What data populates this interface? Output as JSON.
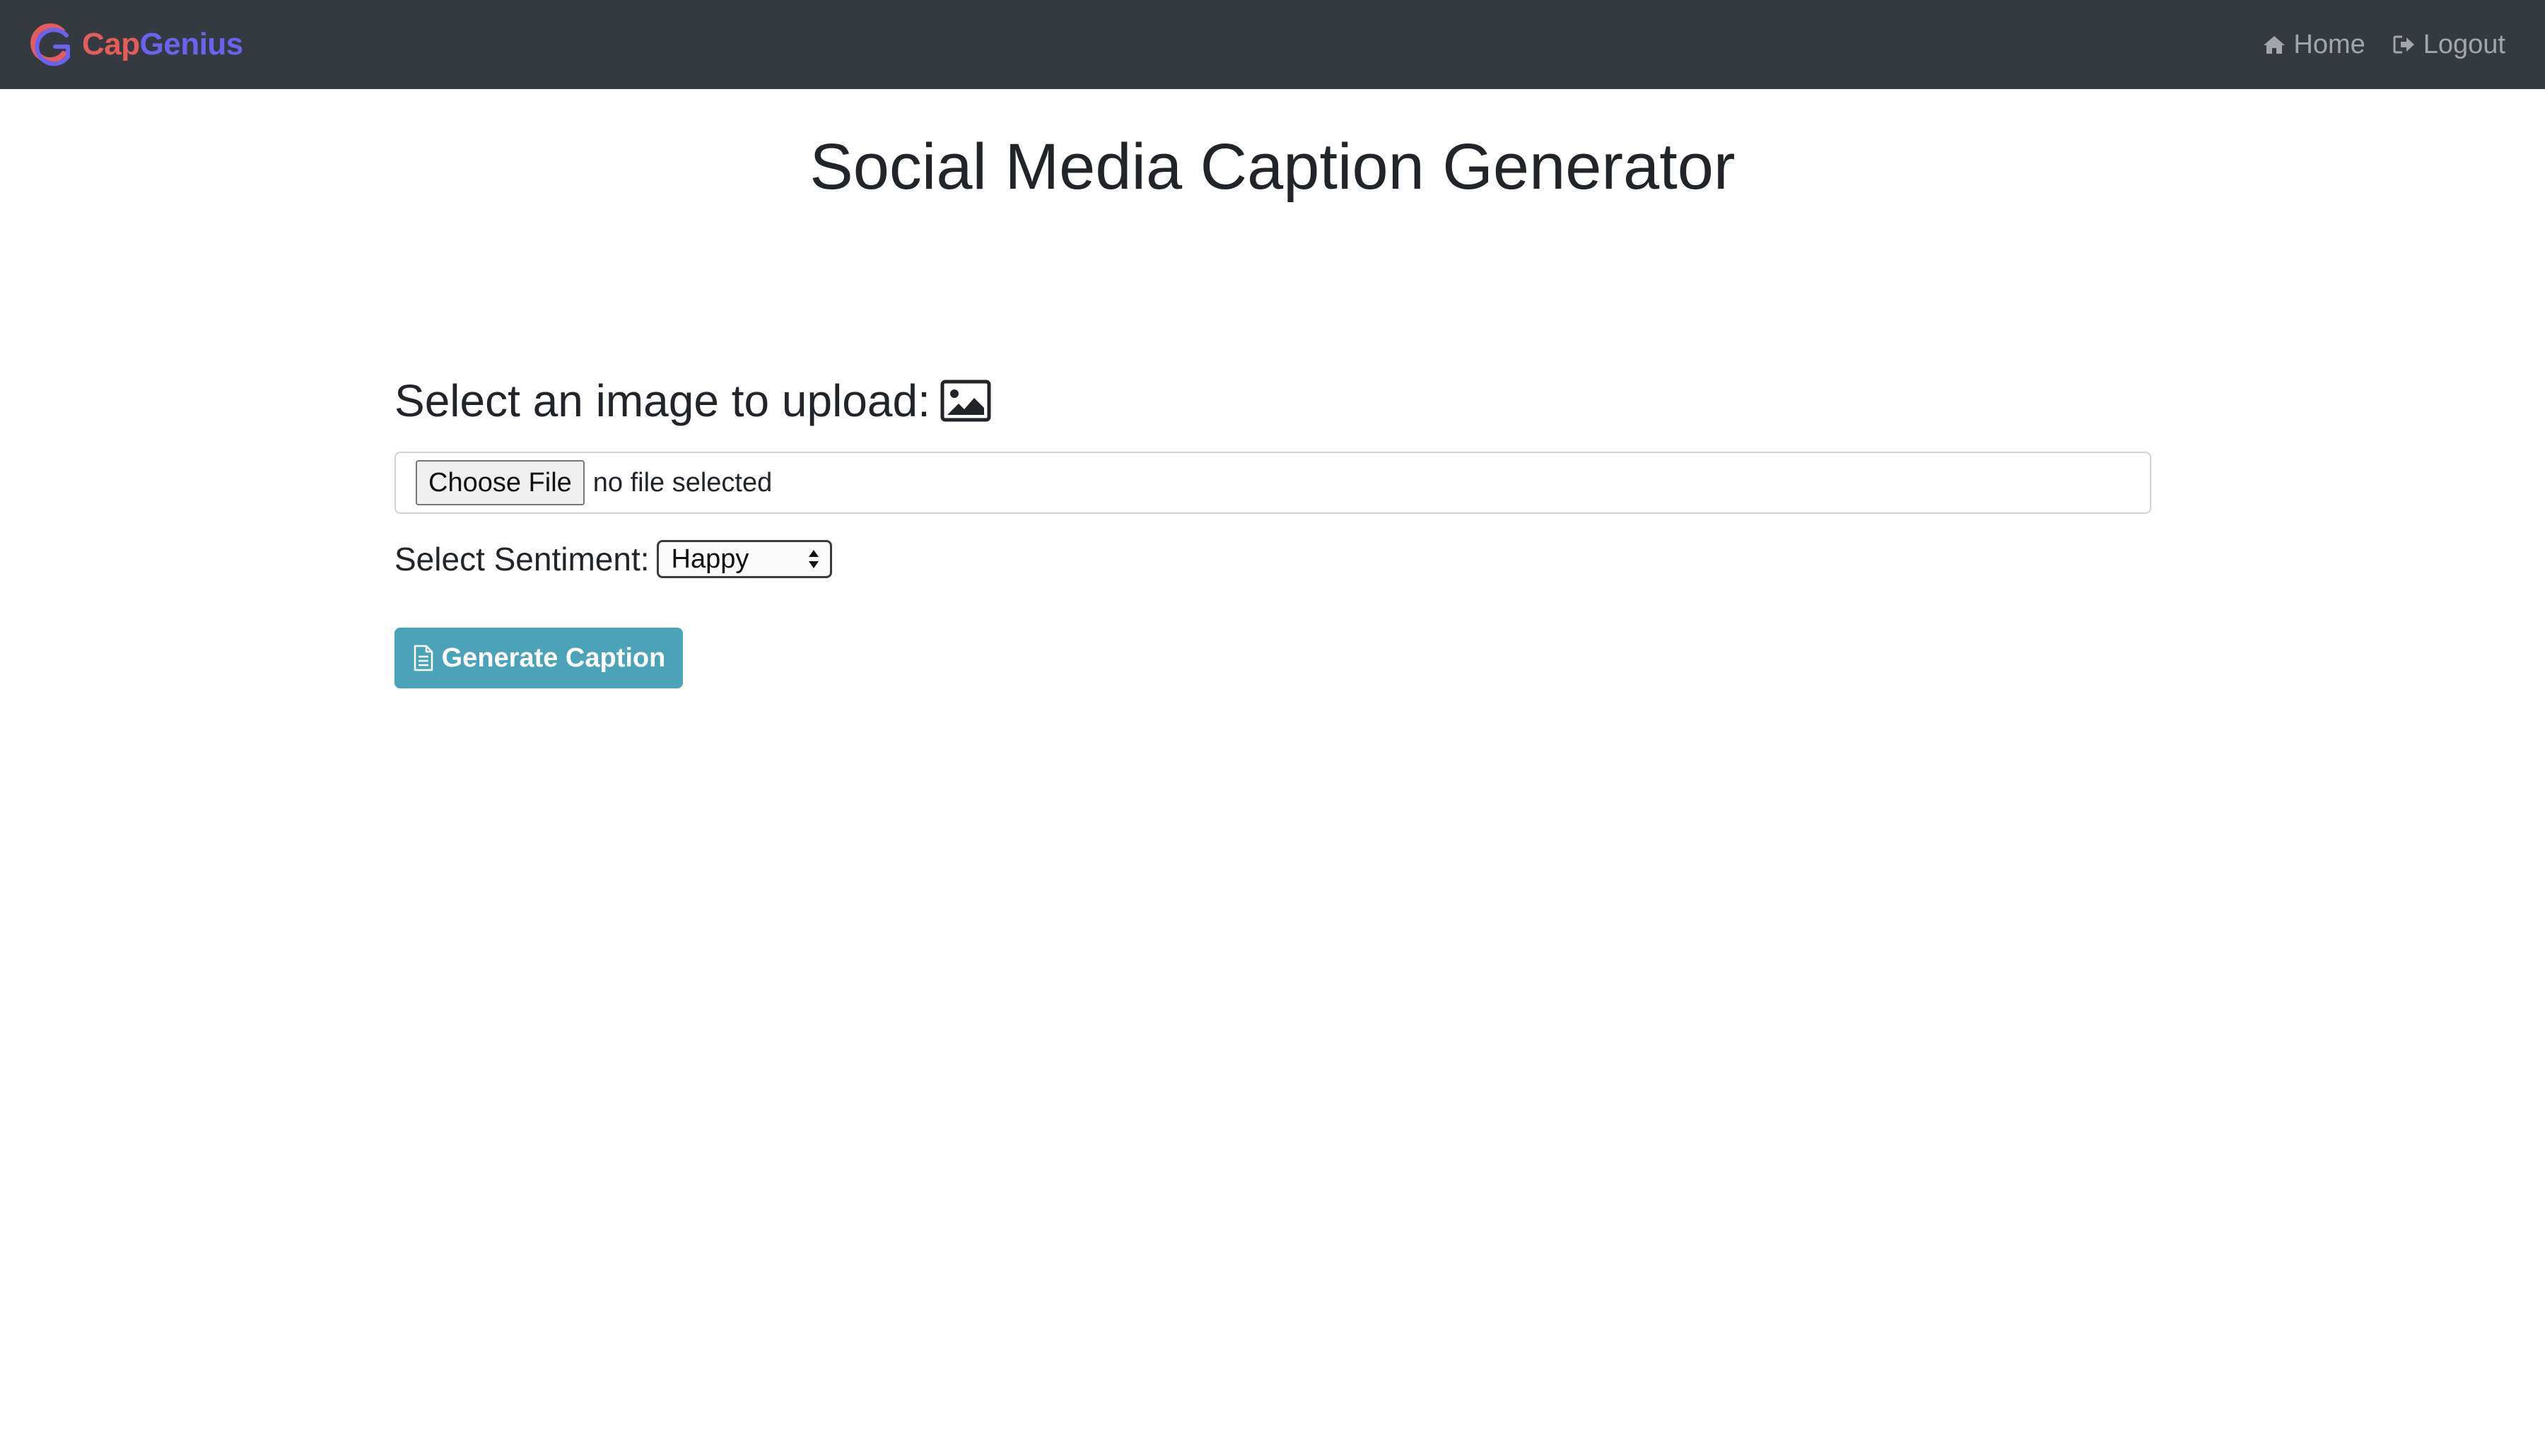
{
  "navbar": {
    "brand_part1": "Cap",
    "brand_part2": "Genius",
    "brand_colors": {
      "cap": "#e35d5d",
      "genius": "#6b63f0"
    },
    "background": "#343a40",
    "links": [
      {
        "label": "Home",
        "icon": "home-icon"
      },
      {
        "label": "Logout",
        "icon": "logout-icon"
      }
    ]
  },
  "main": {
    "title": "Social Media Caption Generator",
    "upload": {
      "heading": "Select an image to upload:",
      "icon": "image-icon",
      "choose_button": "Choose File",
      "file_status": "no file selected"
    },
    "sentiment": {
      "label": "Select Sentiment:",
      "selected": "Happy"
    },
    "generate_button": {
      "label": "Generate Caption",
      "icon": "document-icon",
      "color": "#4aa3b9"
    }
  }
}
